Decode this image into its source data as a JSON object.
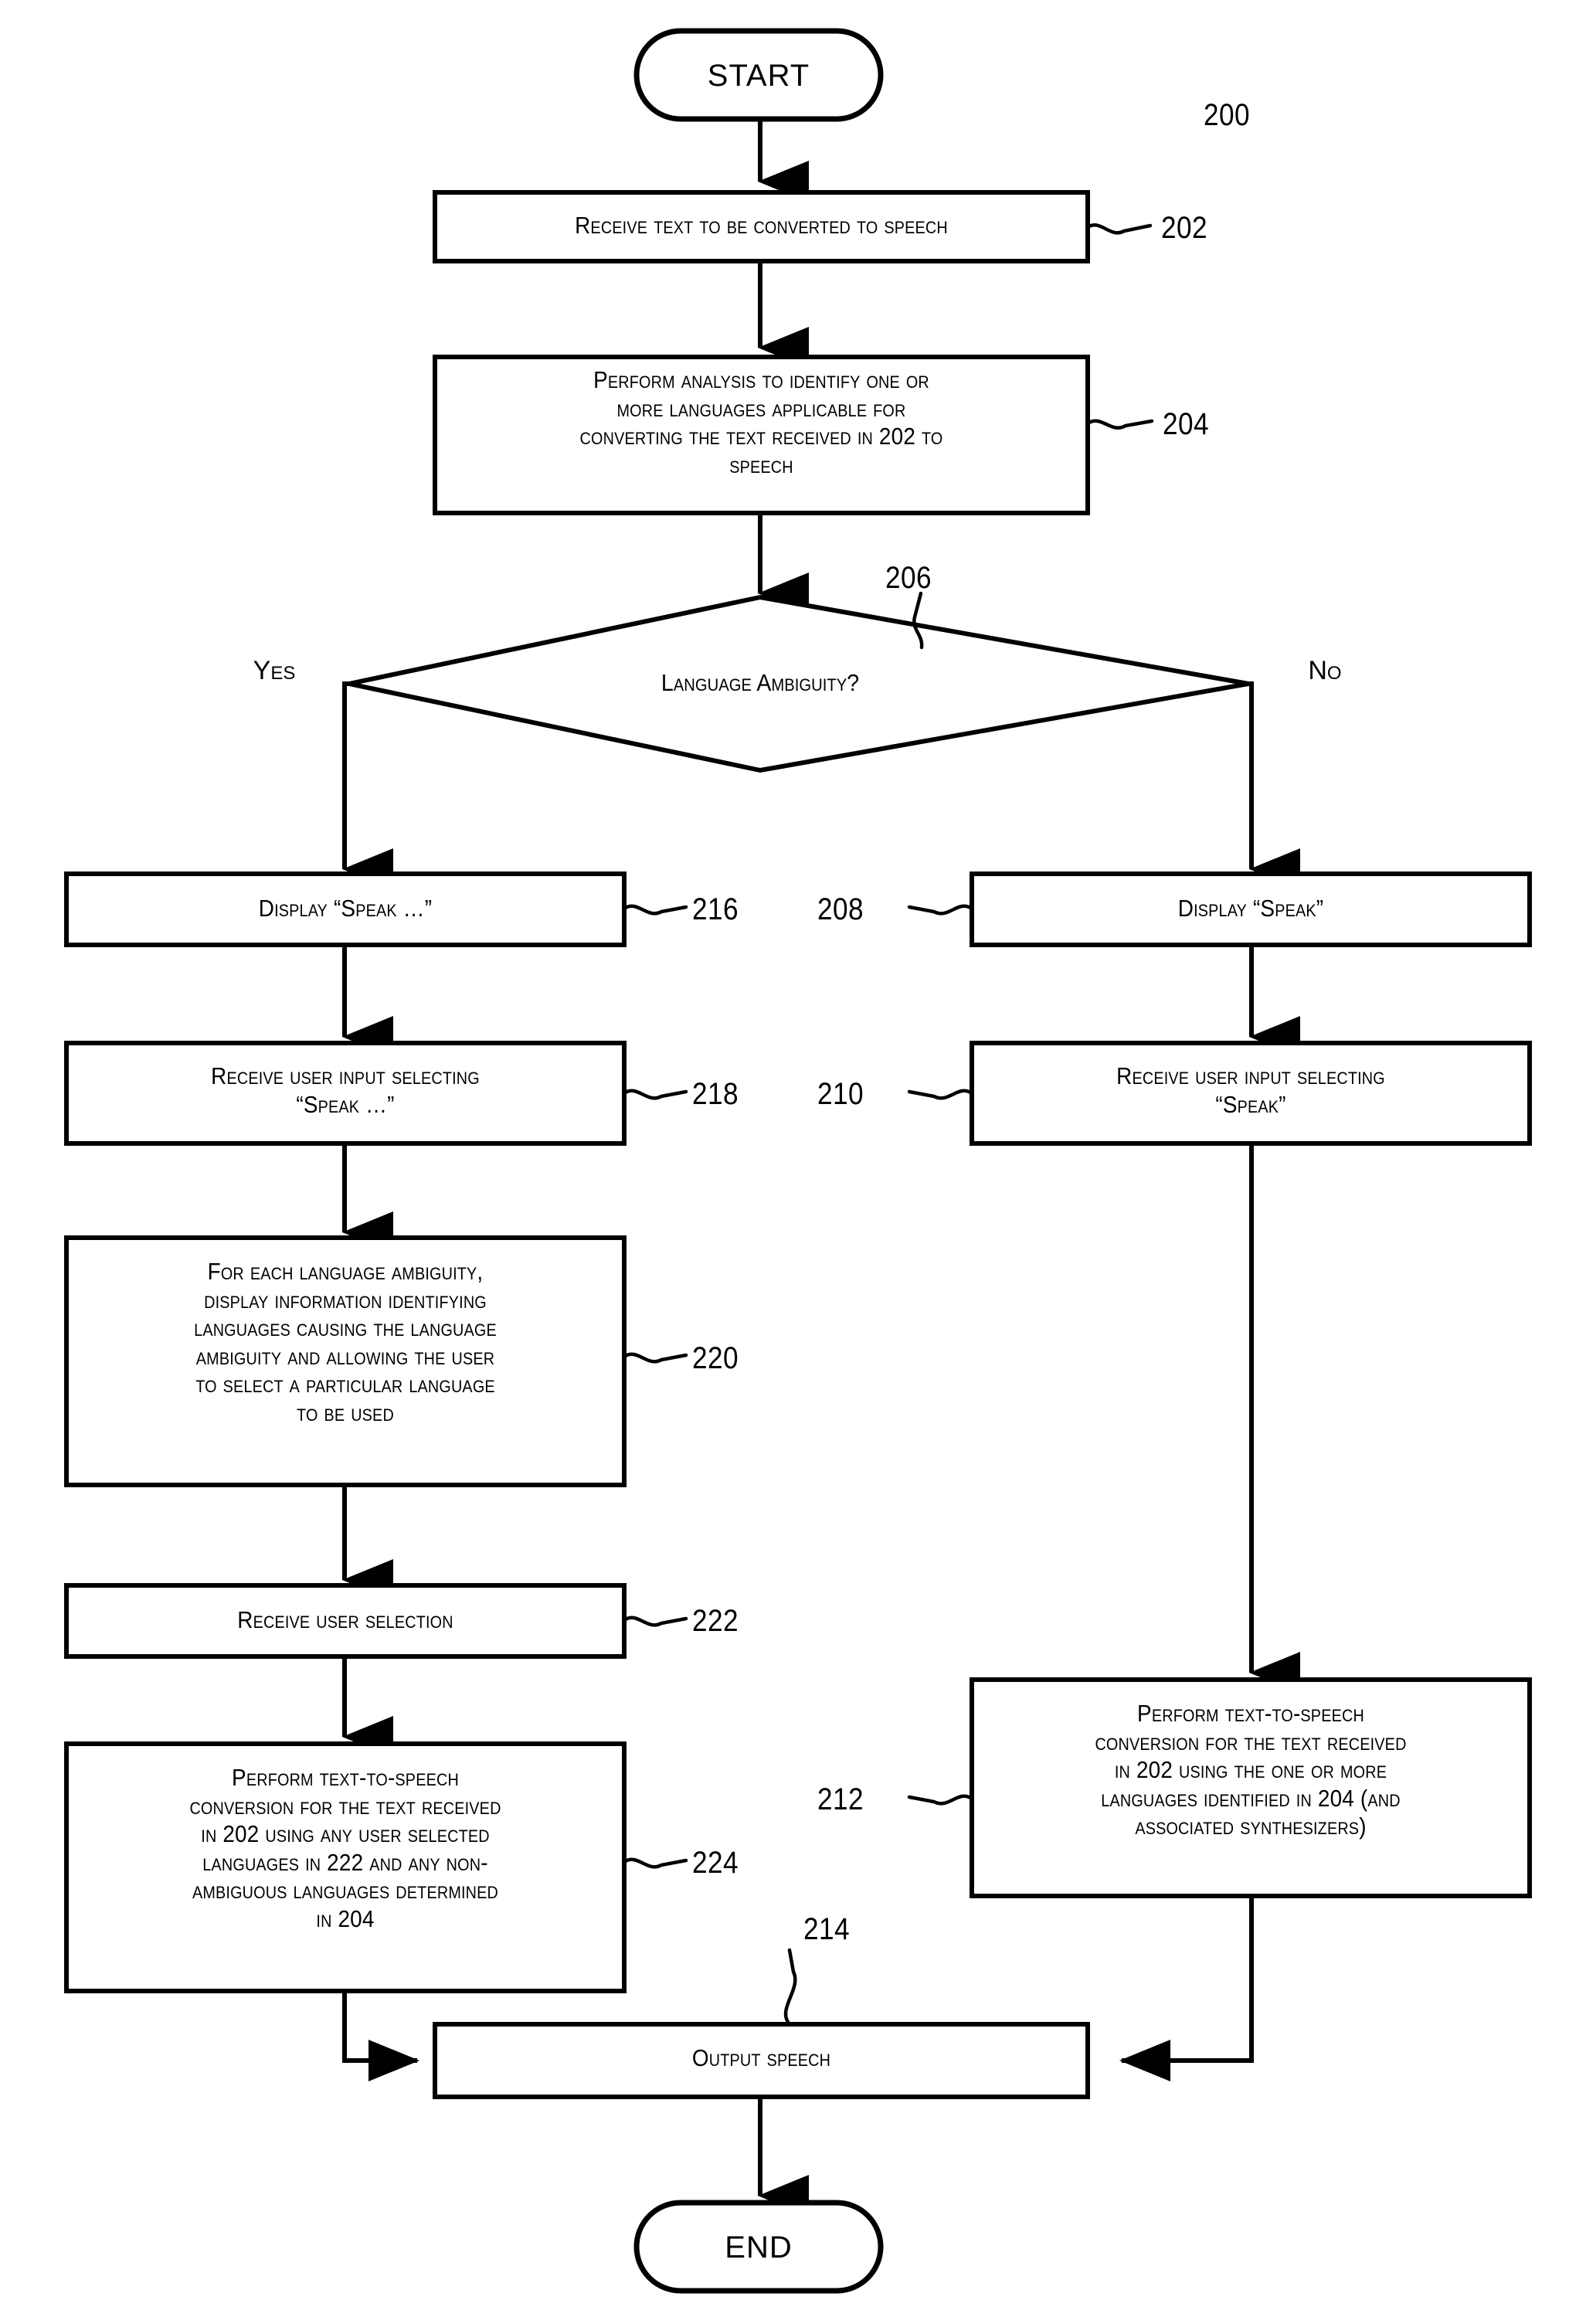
{
  "figure": {
    "reference_number": "200",
    "terminators": {
      "start": "START",
      "end": "END"
    },
    "branch_labels": {
      "yes": "Yes",
      "no": "No"
    },
    "decision": {
      "ref": "206",
      "text": "Language Ambiguity?"
    },
    "steps": [
      {
        "ref": "202",
        "lines": [
          "Receive text to be converted to speech"
        ]
      },
      {
        "ref": "204",
        "lines": [
          "Perform analysis to identify one or",
          "more languages applicable for",
          "converting the text received in 202 to",
          "speech"
        ]
      },
      {
        "ref": "216",
        "lines": [
          "Display “Speak …”"
        ]
      },
      {
        "ref": "208",
        "lines": [
          "Display “Speak”"
        ]
      },
      {
        "ref": "218",
        "lines": [
          "Receive user input selecting",
          "“Speak …”"
        ]
      },
      {
        "ref": "210",
        "lines": [
          "Receive user input selecting",
          "“Speak”"
        ]
      },
      {
        "ref": "220",
        "lines": [
          "For each language ambiguity,",
          "display information identifying",
          "languages causing the language",
          "ambiguity and allowing the user",
          "to select a particular language",
          "to be used"
        ]
      },
      {
        "ref": "222",
        "lines": [
          "Receive user selection"
        ]
      },
      {
        "ref": "224",
        "lines": [
          "Perform text-to-speech",
          "conversion for the text received",
          "in 202 using any user selected",
          "languages in 222 and any non-",
          "ambiguous languages determined",
          "in 204"
        ]
      },
      {
        "ref": "212",
        "lines": [
          "Perform text-to-speech",
          "conversion for the text received",
          "in 202 using the one or more",
          "languages identified in 204 (and",
          "associated synthesizers)"
        ]
      },
      {
        "ref": "214",
        "lines": [
          "Output speech"
        ]
      }
    ]
  }
}
